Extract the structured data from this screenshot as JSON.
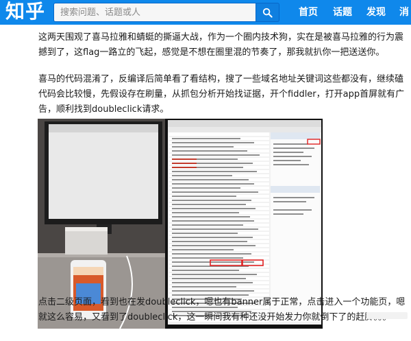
{
  "header": {
    "logo": "知乎",
    "search_placeholder": "搜索问题、话题或人",
    "nav": [
      "首页",
      "话题",
      "发现",
      "消息"
    ]
  },
  "article": {
    "paragraphs": [
      "这两天围观了喜马拉雅和蜻蜓的撕逼大战，作为一个圈内技术狗，实在是被喜马拉雅的行为震撼到了，这flag一路立的飞起，感觉是不想在圈里混的节奏了，那我就扒你一把送送你。",
      "喜马的代码混淆了，反编译后简单看了看结构，搜了一些域名地址关键词这些都没有，继续磕代码会比较慢，先假设存在刷量，从抓包分析开始找证据，开个fiddler，打开app首屏就有广告，顺利找到doubleclick请求。",
      "点击二级页面，看到也在发doubleclick，嗯也有banner属于正常，点击进入一个功能页，嗯就这么容易，又看到了doubleclick，这一瞬间我有种还没开始发力你就倒下了的赶脚。。。"
    ]
  },
  "photo": {
    "description_icon": "photo-icon"
  },
  "colors": {
    "brand": "#0f88eb",
    "text": "#1a1a1a",
    "highlight": "#e02020"
  }
}
